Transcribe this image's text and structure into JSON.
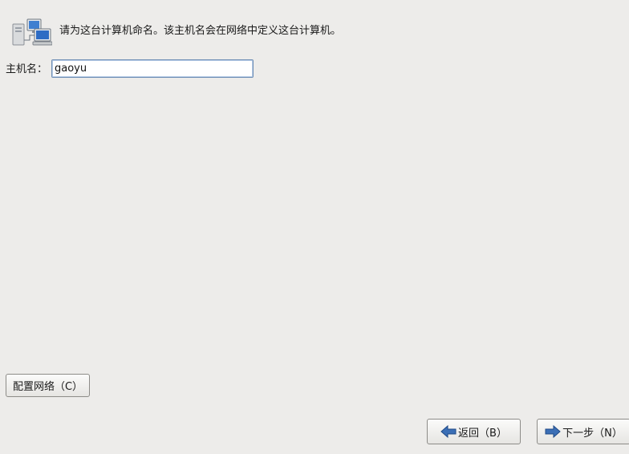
{
  "header": {
    "icon": "network-computers-icon",
    "instruction": "请为这台计算机命名。该主机名会在网络中定义这台计算机。"
  },
  "hostname": {
    "label": "主机名：",
    "value": "gaoyu"
  },
  "buttons": {
    "configure_network": "配置网络（C）",
    "back": "返回（B）",
    "next": "下一步（N）"
  },
  "colors": {
    "background": "#edecea",
    "arrow_blue": "#3b6fb6"
  }
}
